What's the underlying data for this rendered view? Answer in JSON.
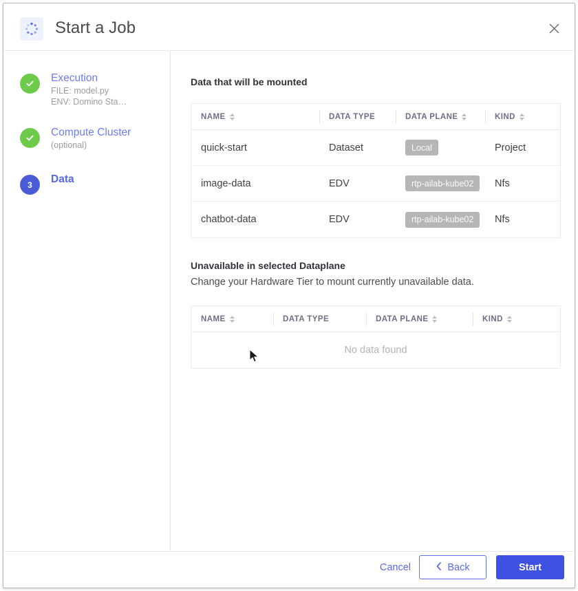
{
  "dialog": {
    "title": "Start a Job",
    "header_icon": "spinner-dots-icon",
    "close_icon": "close-icon"
  },
  "sidebar": {
    "steps": [
      {
        "badge": "✓",
        "state": "done",
        "title": "Execution",
        "sub1": "FILE: model.py",
        "sub2": "ENV: Domino Sta…"
      },
      {
        "badge": "✓",
        "state": "done",
        "title": "Compute Cluster",
        "sub1": "(optional)",
        "sub2": ""
      },
      {
        "badge": "3",
        "state": "active",
        "title": "Data",
        "sub1": "",
        "sub2": ""
      }
    ]
  },
  "content": {
    "mounted": {
      "heading": "Data that will be mounted",
      "columns": [
        {
          "label": "NAME",
          "sortable": true
        },
        {
          "label": "DATA TYPE",
          "sortable": false
        },
        {
          "label": "DATA PLANE",
          "sortable": true
        },
        {
          "label": "KIND",
          "sortable": true
        }
      ],
      "rows": [
        {
          "name": "quick-start",
          "data_type": "Dataset",
          "data_plane": "Local",
          "kind": "Project"
        },
        {
          "name": "image-data",
          "data_type": "EDV",
          "data_plane": "rtp-ailab-kube02",
          "kind": "Nfs"
        },
        {
          "name": "chatbot-data",
          "data_type": "EDV",
          "data_plane": "rtp-ailab-kube02",
          "kind": "Nfs"
        }
      ]
    },
    "unavailable": {
      "heading": "Unavailable in selected Dataplane",
      "subheading": "Change your Hardware Tier to mount currently unavailable data.",
      "columns": [
        {
          "label": "NAME",
          "sortable": true
        },
        {
          "label": "DATA TYPE",
          "sortable": false
        },
        {
          "label": "DATA PLANE",
          "sortable": true
        },
        {
          "label": "KIND",
          "sortable": true
        }
      ],
      "empty_text": "No data found"
    }
  },
  "footer": {
    "cancel_label": "Cancel",
    "back_label": "Back",
    "back_icon": "chevron-left-icon",
    "start_label": "Start"
  },
  "colors": {
    "accent": "#3f51e0",
    "link": "#5b6ae8",
    "step_done": "#6ecb4a",
    "step_active": "#4a5bd6",
    "badge_gray": "#b6b6b6"
  }
}
